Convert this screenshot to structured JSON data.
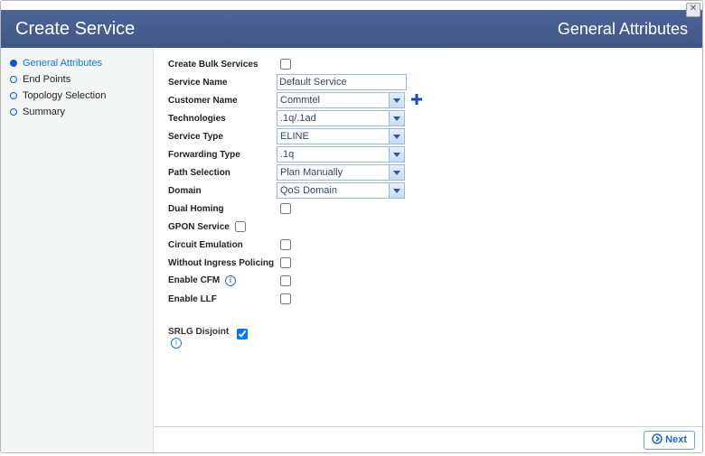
{
  "window": {
    "close_glyph": "✕"
  },
  "header": {
    "title_left": "Create Service",
    "title_right": "General Attributes"
  },
  "sidebar": {
    "items": [
      {
        "label": "General Attributes",
        "current": true
      },
      {
        "label": "End Points",
        "current": false
      },
      {
        "label": "Topology Selection",
        "current": false
      },
      {
        "label": "Summary",
        "current": false
      }
    ]
  },
  "form": {
    "create_bulk_services": {
      "label": "Create Bulk Services",
      "checked": false
    },
    "service_name": {
      "label": "Service Name",
      "value": "Default Service"
    },
    "customer_name": {
      "label": "Customer Name",
      "value": "Commtel"
    },
    "technologies": {
      "label": "Technologies",
      "value": ".1q/.1ad"
    },
    "service_type": {
      "label": "Service Type",
      "value": "ELINE"
    },
    "forwarding_type": {
      "label": "Forwarding Type",
      "value": ".1q"
    },
    "path_selection": {
      "label": "Path Selection",
      "value": "Plan Manually"
    },
    "domain": {
      "label": "Domain",
      "value": "QoS Domain"
    },
    "dual_homing": {
      "label": "Dual Homing",
      "checked": false
    },
    "gpon_service": {
      "label": "GPON Service",
      "checked": false
    },
    "circuit_emulation": {
      "label": "Circuit Emulation",
      "checked": false
    },
    "without_ingress_policing": {
      "label": "Without Ingress Policing",
      "checked": false
    },
    "enable_cfm": {
      "label": "Enable CFM",
      "checked": false
    },
    "enable_llf": {
      "label": "Enable LLF",
      "checked": false
    },
    "srlg_disjoint": {
      "label": "SRLG Disjoint",
      "checked": true
    }
  },
  "icons": {
    "info_glyph": "i",
    "plus_svg_title": "Add customer"
  },
  "footer": {
    "next_label": "Next"
  }
}
